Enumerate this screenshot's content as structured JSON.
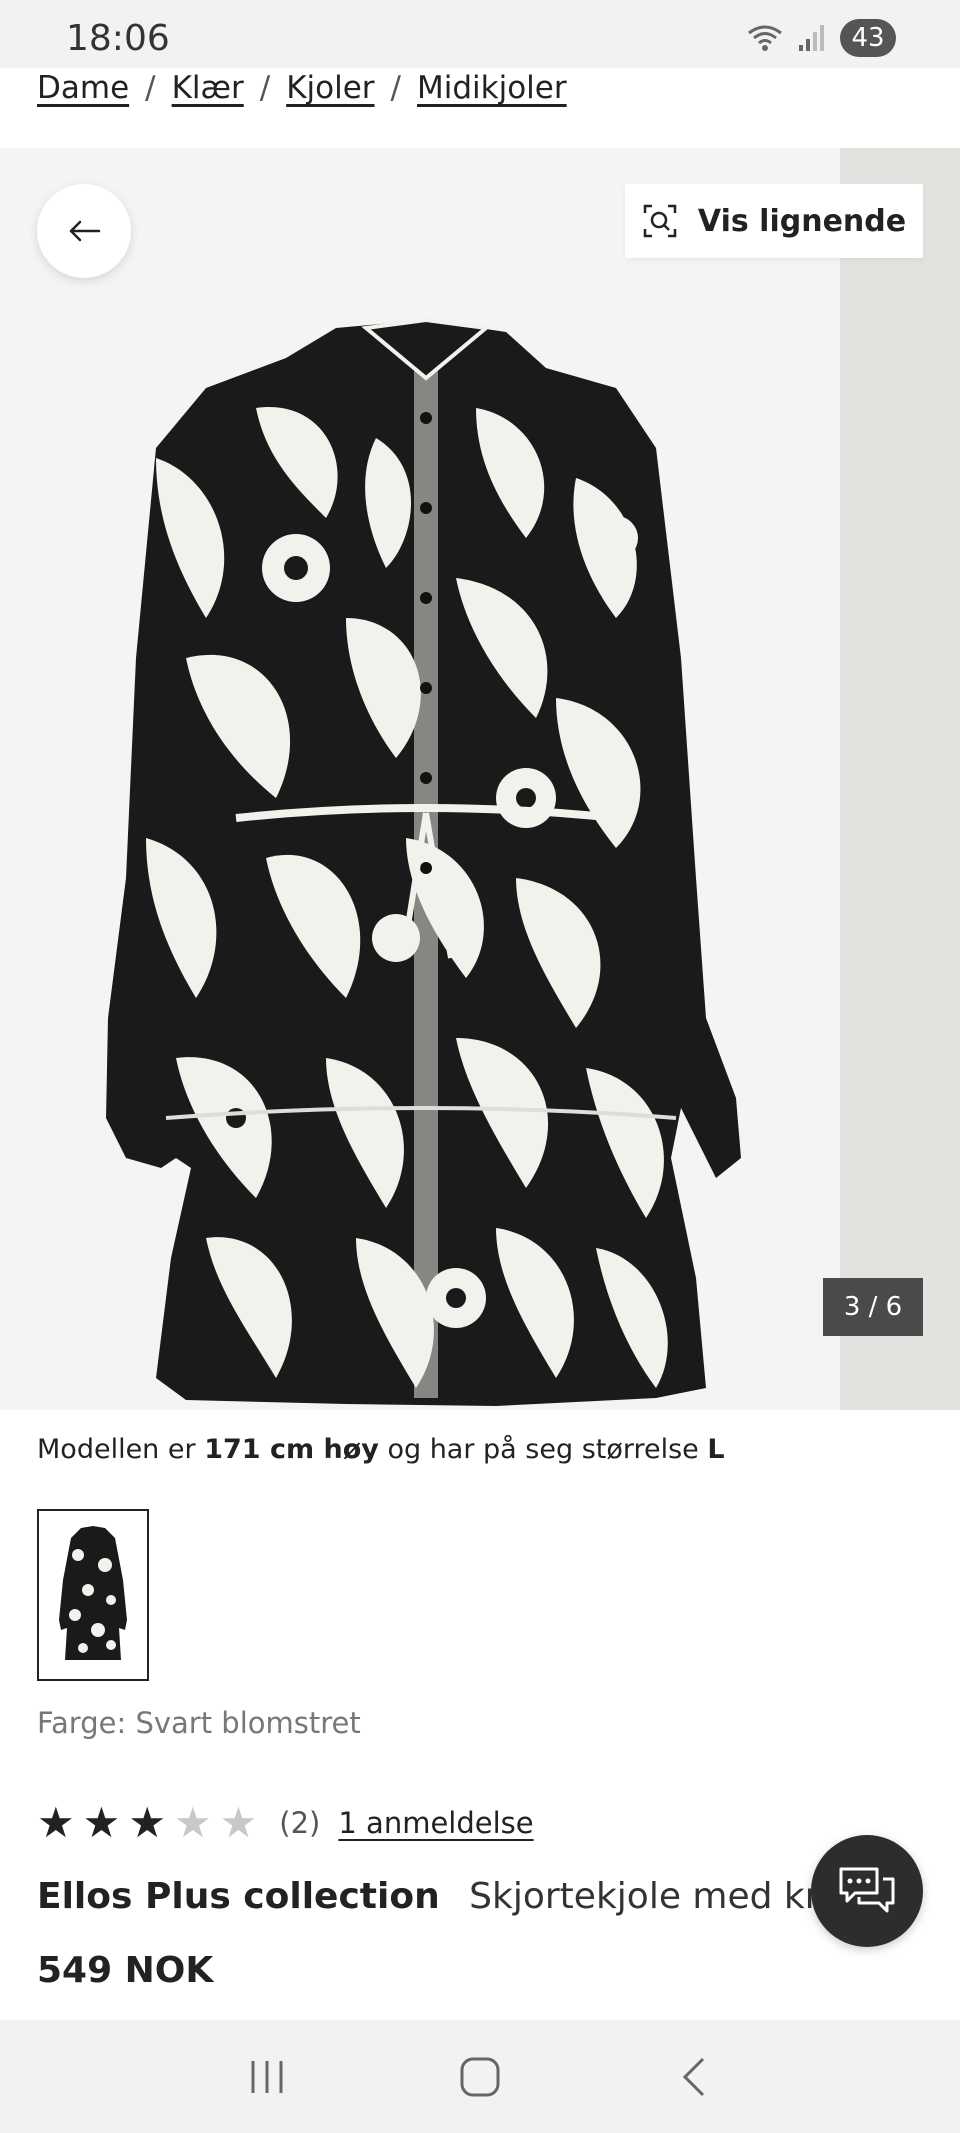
{
  "status": {
    "time": "18:06",
    "battery": "43"
  },
  "breadcrumb": [
    "Dame",
    "Klær",
    "Kjoler",
    "Midikjoler"
  ],
  "gallery": {
    "similar_label": "Vis lignende",
    "counter": "3 / 6"
  },
  "model_info": {
    "prefix": "Modellen er",
    "height": "171 cm høy",
    "middle": "og har på seg størrelse",
    "size": "L"
  },
  "color": "Farge: Svart blomstret",
  "rating": {
    "value": 3,
    "max": 5,
    "count": "(2)",
    "reviews_link": "1 anmeldelse"
  },
  "product": {
    "brand": "Ellos Plus collection",
    "name": "Skjortekjole med knytbelte",
    "price": "549 NOK"
  },
  "colors": {
    "dress_black": "#1a1a1a",
    "print_white": "#f3f1ec",
    "gallery_bg": "#f4f4f4",
    "chat_bg": "#2d2d2d"
  }
}
